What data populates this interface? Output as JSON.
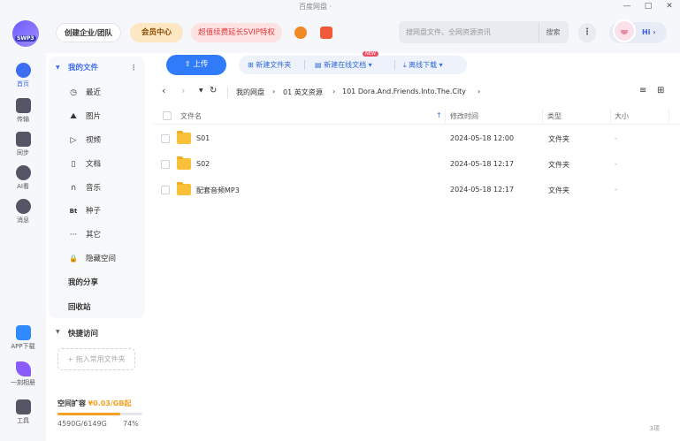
{
  "titlebar": {
    "title": "百度网盘 ·",
    "controls": [
      "—",
      "□",
      "✕"
    ]
  },
  "topbar": {
    "logo_text": "SWP3",
    "enterprise_label": "创建企业/团队",
    "member_label": "会员中心",
    "promo_label": "超值续费延长SVIP特权",
    "search_placeholder": "搜网盘文件、全网资源资讯",
    "search_button": "搜索",
    "more_label": "⋮",
    "greeting": "Hi ›"
  },
  "rail": [
    {
      "label": "首页",
      "icon": "home-icon",
      "color": "#3d6df2"
    },
    {
      "label": "传输",
      "icon": "transfer-icon",
      "color": "#556"
    },
    {
      "label": "同步",
      "icon": "sync-icon",
      "color": "#556"
    },
    {
      "label": "AI看",
      "icon": "ai-icon",
      "color": "#556"
    },
    {
      "label": "消息",
      "icon": "message-icon",
      "color": "#556"
    },
    {
      "label": "APP下载",
      "icon": "app-download-icon",
      "color": "#2f8bff"
    },
    {
      "label": "一刻相册",
      "icon": "album-icon",
      "color": "#8a5cff"
    },
    {
      "label": "工具",
      "icon": "tools-icon",
      "color": "#556"
    }
  ],
  "nav": {
    "my_files": "我的文件",
    "items": [
      {
        "label": "最近",
        "icon": "◷"
      },
      {
        "label": "图片",
        "icon": "⛰"
      },
      {
        "label": "视频",
        "icon": "▷"
      },
      {
        "label": "文档",
        "icon": "▯"
      },
      {
        "label": "音乐",
        "icon": "∩"
      },
      {
        "label": "种子",
        "icon": "Bt"
      },
      {
        "label": "其它",
        "icon": "···"
      },
      {
        "label": "隐藏空间",
        "icon": "🔒"
      }
    ],
    "my_share": "我的分享",
    "recycle": "回收站",
    "quick_access": "快捷访问",
    "drag_hint": "+ 拖入常用文件夹",
    "quota": {
      "title": "空间扩容",
      "price": "¥0.03/GB起",
      "used": "4590G/6149G",
      "percent_label": "74%",
      "fraction": 0.74
    }
  },
  "toolbar": {
    "upload": "上传",
    "new_folder": "新建文件夹",
    "new_doc": "新建在线文档 ▾",
    "new_badge": "NEW",
    "offline": "离线下载 ▾"
  },
  "breadcrumb": [
    "我的网盘",
    "01 英文资源",
    "101 Dora.And.Friends.Into.The.City"
  ],
  "table": {
    "headers": {
      "name": "文件名",
      "time": "修改时间",
      "type": "类型",
      "size": "大小"
    },
    "rows": [
      {
        "name": "S01",
        "time": "2024-05-18 12:00",
        "type": "文件夹",
        "size": "-"
      },
      {
        "name": "S02",
        "time": "2024-05-18 12:17",
        "type": "文件夹",
        "size": "-"
      },
      {
        "name": "配套音频MP3",
        "time": "2024-05-18 12:17",
        "type": "文件夹",
        "size": "-"
      }
    ]
  },
  "item_count": "3项"
}
